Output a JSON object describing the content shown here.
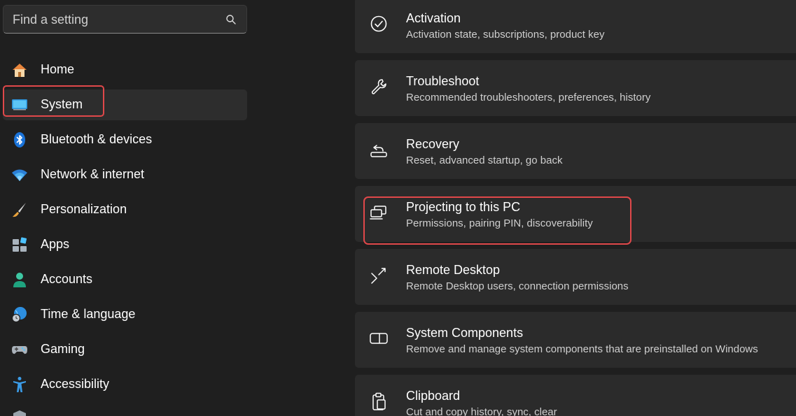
{
  "search": {
    "placeholder": "Find a setting",
    "icon": "search-icon"
  },
  "sidebar": {
    "items": [
      {
        "label": "Home",
        "icon": "home-icon"
      },
      {
        "label": "System",
        "icon": "system-monitor-icon",
        "selected": true
      },
      {
        "label": "Bluetooth & devices",
        "icon": "bluetooth-icon"
      },
      {
        "label": "Network & internet",
        "icon": "wifi-icon"
      },
      {
        "label": "Personalization",
        "icon": "paintbrush-icon"
      },
      {
        "label": "Apps",
        "icon": "apps-icon"
      },
      {
        "label": "Accounts",
        "icon": "person-icon"
      },
      {
        "label": "Time & language",
        "icon": "globe-clock-icon"
      },
      {
        "label": "Gaming",
        "icon": "gamepad-icon"
      },
      {
        "label": "Accessibility",
        "icon": "accessibility-icon"
      }
    ]
  },
  "cards": [
    {
      "title": "Activation",
      "subtitle": "Activation state, subscriptions, product key",
      "icon": "check-circle-icon"
    },
    {
      "title": "Troubleshoot",
      "subtitle": "Recommended troubleshooters, preferences, history",
      "icon": "wrench-icon"
    },
    {
      "title": "Recovery",
      "subtitle": "Reset, advanced startup, go back",
      "icon": "recovery-icon"
    },
    {
      "title": "Projecting to this PC",
      "subtitle": "Permissions, pairing PIN, discoverability",
      "icon": "projecting-icon"
    },
    {
      "title": "Remote Desktop",
      "subtitle": "Remote Desktop users, connection permissions",
      "icon": "remote-desktop-icon"
    },
    {
      "title": "System Components",
      "subtitle": "Remove and manage system components that are preinstalled on Windows",
      "icon": "system-components-icon"
    },
    {
      "title": "Clipboard",
      "subtitle": "Cut and copy history, sync, clear",
      "icon": "clipboard-icon"
    }
  ],
  "colors": {
    "background": "#1f1f1f",
    "card": "#2b2b2b",
    "highlight": "#e0484a",
    "accent": "#4cc2ff"
  }
}
